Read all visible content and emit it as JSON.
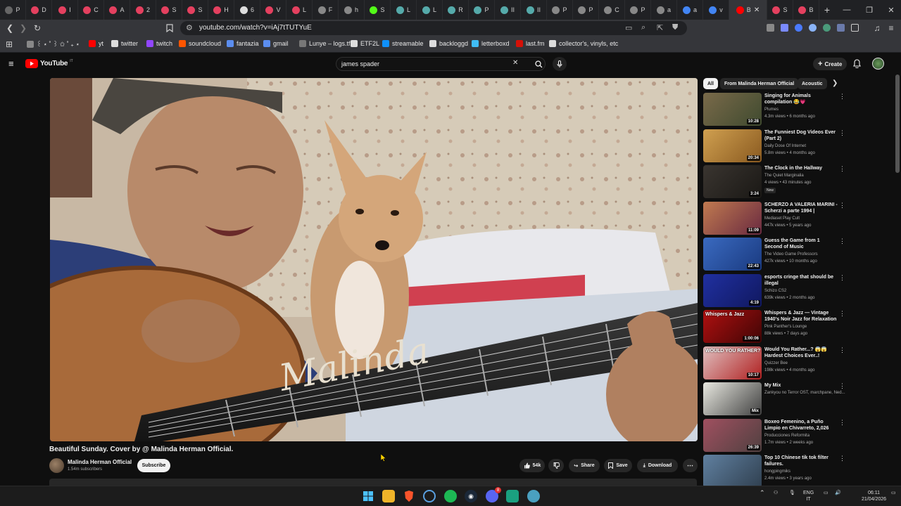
{
  "browser": {
    "tabs": [
      {
        "letter": "P",
        "color": "#666"
      },
      {
        "letter": "D",
        "color": "#e4405f"
      },
      {
        "letter": "I",
        "color": "#e4405f"
      },
      {
        "letter": "C",
        "color": "#e4405f"
      },
      {
        "letter": "A",
        "color": "#e4405f"
      },
      {
        "letter": "2",
        "color": "#e4405f"
      },
      {
        "letter": "S",
        "color": "#e4405f"
      },
      {
        "letter": "S",
        "color": "#e4405f"
      },
      {
        "letter": "H",
        "color": "#e4405f"
      },
      {
        "letter": "6",
        "color": "#ddd"
      },
      {
        "letter": "V",
        "color": "#e4405f"
      },
      {
        "letter": "L",
        "color": "#e4405f"
      },
      {
        "letter": "F",
        "color": "#888"
      },
      {
        "letter": "h",
        "color": "#888"
      },
      {
        "letter": "S",
        "color": "#53fc18"
      },
      {
        "letter": "L",
        "color": "#5aa"
      },
      {
        "letter": "L",
        "color": "#5aa"
      },
      {
        "letter": "R",
        "color": "#5aa"
      },
      {
        "letter": "P",
        "color": "#5aa"
      },
      {
        "letter": "II",
        "color": "#5aa"
      },
      {
        "letter": "II",
        "color": "#5aa"
      },
      {
        "letter": "P",
        "color": "#888"
      },
      {
        "letter": "P",
        "color": "#888"
      },
      {
        "letter": "C",
        "color": "#888"
      },
      {
        "letter": "P",
        "color": "#888"
      },
      {
        "letter": "a",
        "color": "#888"
      },
      {
        "letter": "a",
        "color": "#4285f4"
      },
      {
        "letter": "v",
        "color": "#4285f4"
      }
    ],
    "active_tab": {
      "letter": "B",
      "close": "✕"
    },
    "after_tabs": [
      {
        "letter": "S",
        "color": "#e4405f"
      },
      {
        "letter": "B",
        "color": "#e4405f"
      }
    ],
    "new_tab": "+",
    "url": "youtube.com/watch?v=iAj7tTUTYuE"
  },
  "bookmarks": [
    {
      "label": "꒰ ⋆ ˚ ꒱ ✩ ˚ ₊ ⋆",
      "color": "#888"
    },
    {
      "label": "yt",
      "color": "#ff0000"
    },
    {
      "label": "twitter",
      "color": "#ddd"
    },
    {
      "label": "twitch",
      "color": "#9146ff"
    },
    {
      "label": "soundcloud",
      "color": "#ff5500"
    },
    {
      "label": "fantazia",
      "color": "#5b8def"
    },
    {
      "label": "gmail",
      "color": "#5b8def"
    },
    {
      "label": "Lunye – logs.tf",
      "color": "#777"
    },
    {
      "label": "ETF2L",
      "color": "#ddd"
    },
    {
      "label": "streamable",
      "color": "#0f90fa"
    },
    {
      "label": "backloggd",
      "color": "#ddd"
    },
    {
      "label": "letterboxd",
      "color": "#40bcf4"
    },
    {
      "label": "last.fm",
      "color": "#d51007"
    },
    {
      "label": "collector's, vinyls, etc",
      "color": "#ddd"
    }
  ],
  "youtube": {
    "logo": "YouTube",
    "logo_region": "IT",
    "search_value": "james spader",
    "create_label": "Create"
  },
  "video": {
    "title": "Beautiful Sunday. Cover by @ Malinda Herman Official.",
    "guitar_inlay": "Malinda",
    "channel": "Malinda Herman Official",
    "subscribers": "1.54m subscribers",
    "subscribe_label": "Subscribe",
    "likes": "54k",
    "share_label": "Share",
    "save_label": "Save",
    "download_label": "Download"
  },
  "sidebar": {
    "chips": [
      "All",
      "From Malinda Herman Official",
      "Acoustic"
    ],
    "recommendations": [
      {
        "title": "Singing for Animals compilation 😂💗",
        "channel": "Plumes",
        "meta": "4.3m views • 6 months ago",
        "duration": "10:28",
        "colors": [
          "#7a6a4a",
          "#3f4a2f"
        ]
      },
      {
        "title": "The Funniest Dog Videos Ever (Part 2)",
        "channel": "Daily Dose Of Internet",
        "meta": "5.8m views • 4 months ago",
        "duration": "20:34",
        "colors": [
          "#d0a050",
          "#8a5a20"
        ]
      },
      {
        "title": "The Clock in the Hallway",
        "channel": "The Quiet Marginalia",
        "meta": "4 views • 43 minutes ago",
        "duration": "3:24",
        "badge": "New",
        "colors": [
          "#3a3530",
          "#1a1815"
        ]
      },
      {
        "title": "SCHERZO A VALERIA MARINI - Scherzi a parte 1994 | Mediaset...",
        "channel": "Mediaset Play Cult",
        "meta": "447k views • 5 years ago",
        "duration": "11:09",
        "colors": [
          "#c07a50",
          "#6a2a40"
        ]
      },
      {
        "title": "Guess the Game from 1 Second of Music",
        "channel": "The Video Game Professors",
        "meta": "427k views • 10 months ago",
        "duration": "22:43",
        "colors": [
          "#3a6ac0",
          "#1a3a80"
        ]
      },
      {
        "title": "esports cringe that should be illegal",
        "channel": "Schizo CS2",
        "meta": "639k views • 2 months ago",
        "duration": "4:19",
        "colors": [
          "#2030a0",
          "#101860"
        ]
      },
      {
        "title": "Whispers & Jazz — Vintage 1940's Noir Jazz for Relaxation",
        "channel": "Pink Panther's Lounge",
        "meta": "88k views • 7 days ago",
        "duration": "1:00:06",
        "overlay": "Whispers & Jazz",
        "colors": [
          "#b01010",
          "#400505"
        ]
      },
      {
        "title": "Would You Rather...? 😱😱 Hardest Choices Ever..! Quizze...",
        "channel": "Quizzer Bee",
        "meta": "198k views • 4 months ago",
        "duration": "10:17",
        "overlay": "WOULD YOU RATHER?",
        "colors": [
          "#e0c0c0",
          "#b02020"
        ]
      },
      {
        "title": "My Mix",
        "channel": "Zankyou no Terror OST, marchpane, Ned...",
        "meta": "",
        "duration": "Mix",
        "colors": [
          "#e8e8e0",
          "#404040"
        ]
      },
      {
        "title": "Boxeo Femenino, a Puño Limpio en Chivarreto, 2,026",
        "channel": "Producciones Reformita",
        "meta": "1.7m views • 2 weeks ago",
        "duration": "26:39",
        "colors": [
          "#a05060",
          "#504040"
        ]
      },
      {
        "title": "Top 10 Chinese tik tok filter failures.",
        "channel": "hongpingmiks",
        "meta": "2.4m views • 3 years ago",
        "duration": "",
        "colors": [
          "#6080a0",
          "#304050"
        ]
      }
    ]
  },
  "taskbar": {
    "lang": "ENG",
    "region": "IT",
    "time": "06:11",
    "date": "21/04/2026",
    "discord_badge": "8"
  }
}
